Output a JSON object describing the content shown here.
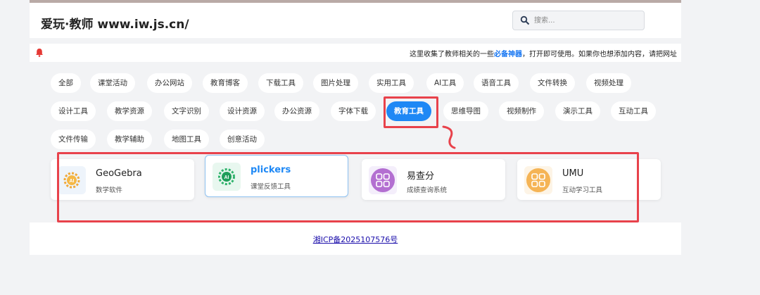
{
  "header": {
    "site_title": "爱玩·教师 www.iw.js.cn/",
    "search_placeholder": "搜索..."
  },
  "notice": {
    "text_before": "这里收集了教师相关的一些",
    "highlight": "必备神器",
    "text_after": "，打开即可使用。如果你也想添加内容，请把网址"
  },
  "categories": {
    "row1": [
      "全部",
      "课堂活动",
      "办公网站",
      "教育博客",
      "下载工具",
      "图片处理",
      "实用工具",
      "AI工具",
      "语音工具",
      "文件转换",
      "视频处理"
    ],
    "row2": [
      "设计工具",
      "教学资源",
      "文字识别",
      "设计资源",
      "办公资源",
      "字体下载",
      "教育工具",
      "思维导图",
      "视频制作",
      "演示工具",
      "互动工具"
    ],
    "row3": [
      "文件传输",
      "教学辅助",
      "地图工具",
      "创意活动"
    ],
    "active": "教育工具"
  },
  "tools": [
    {
      "title": "GeoGebra",
      "desc": "数学软件",
      "icon": "ai-gear-icon"
    },
    {
      "title": "plickers",
      "desc": "课堂反馈工具",
      "icon": "ai-gear-icon"
    },
    {
      "title": "易查分",
      "desc": "成绩查询系统",
      "icon": "grid-app-icon"
    },
    {
      "title": "UMU",
      "desc": "互动学习工具",
      "icon": "grid-app-icon"
    }
  ],
  "footer": {
    "icp": "湘ICP备2025107576号"
  },
  "colors": {
    "accent": "#1e88f5",
    "annotation_red": "#e8424b"
  }
}
